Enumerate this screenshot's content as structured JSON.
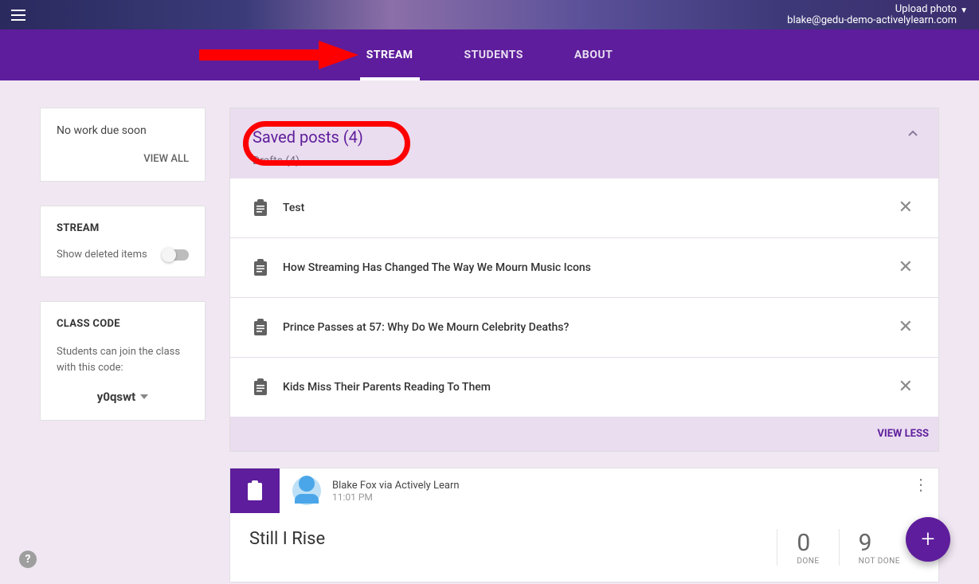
{
  "header": {
    "upload_photo": "Upload photo",
    "user_email": "blake@gedu-demo-activelylearn.com"
  },
  "tabs": {
    "stream": "STREAM",
    "students": "STUDENTS",
    "about": "ABOUT"
  },
  "sidebar": {
    "no_work": "No work due soon",
    "view_all": "VIEW ALL",
    "stream_title": "STREAM",
    "show_deleted": "Show deleted items",
    "class_code_title": "CLASS CODE",
    "class_code_desc": "Students can join the class with this code:",
    "class_code": "y0qswt"
  },
  "saved": {
    "title": "Saved posts (4)",
    "drafts_label": "Drafts (4)",
    "items": [
      "Test",
      "How Streaming Has Changed The Way We Mourn Music Icons",
      "Prince Passes at 57: Why Do We Mourn Celebrity Deaths?",
      "Kids Miss Their Parents Reading To Them"
    ],
    "view_less": "VIEW LESS"
  },
  "post": {
    "author": "Blake Fox via Actively Learn",
    "time": "11:01 PM",
    "title": "Still I Rise",
    "done_num": "0",
    "done_label": "DONE",
    "notdone_num": "9",
    "notdone_label": "NOT DONE"
  }
}
